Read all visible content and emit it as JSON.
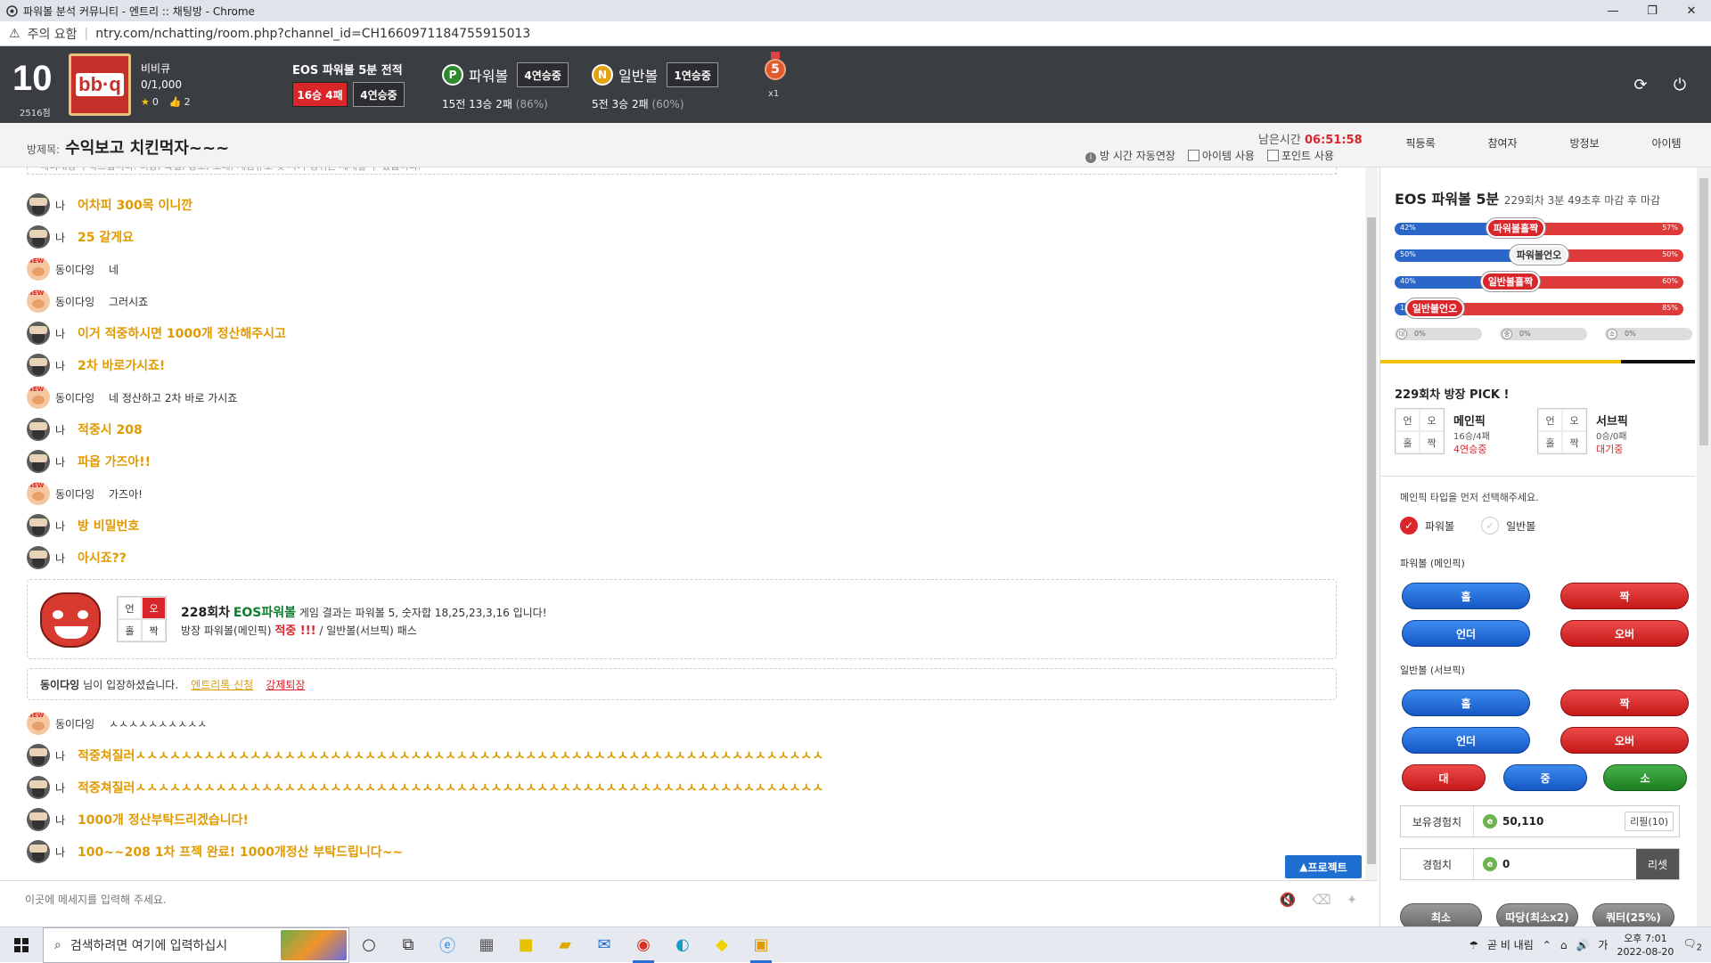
{
  "browser": {
    "title": "파워볼 분석 커뮤니티 - 엔트리 :: 채팅방 - Chrome",
    "warning": "주의 요함",
    "url": "ntry.com/nchatting/room.php?channel_id=CH1660971184755915013"
  },
  "user": {
    "level": "10",
    "points": "2516점",
    "logo_text": "bb·q",
    "name": "비비큐",
    "count": "0/1,000",
    "stars": "0",
    "likes": "2"
  },
  "record": {
    "title": "EOS 파워볼 5분 전적",
    "record_badge": "16승 4패",
    "streak_badge": "4연승중",
    "powerball": {
      "icon": "P",
      "label": "파워볼",
      "streak": "4연승중",
      "summary": "15전 13승 2패",
      "pct": "(86%)"
    },
    "normal": {
      "icon": "N",
      "label": "일반볼",
      "streak": "1연승중",
      "summary": "5전 3승 2패",
      "pct": "(60%)"
    },
    "medal_num": "5",
    "medal_mult": "x1"
  },
  "room": {
    "label": "방제목:",
    "title": "수익보고 치킨먹자~~~",
    "remain_label": "남은시간",
    "remain_time": "06:51:58",
    "opt_auto": "방 시간 자동연장",
    "opt_item": "아이템 사용",
    "opt_point": "포인트 사용",
    "tabs": [
      "픽등록",
      "참여자",
      "방정보",
      "아이템"
    ]
  },
  "chat": {
    "top_cut": "매너채팅 부탁드립니다. 비방, 욕설, 광고, 도배, 게임유도 및 사기 행위는 제재될 수 있습니다.",
    "messages": [
      {
        "who": "나",
        "text": "어차피 300목 이니깐",
        "me": true
      },
      {
        "who": "나",
        "text": "25 갈게요",
        "me": true
      },
      {
        "who": "동이다잉",
        "text": "네",
        "me": false
      },
      {
        "who": "동이다잉",
        "text": "그러시죠",
        "me": false
      },
      {
        "who": "나",
        "text": "이거 적중하시면 1000개 정산해주시고",
        "me": true
      },
      {
        "who": "나",
        "text": "2차 바로가시죠!",
        "me": true
      },
      {
        "who": "동이다잉",
        "text": "네 정산하고 2차 바로 가시죠",
        "me": false
      },
      {
        "who": "나",
        "text": "적중시 208",
        "me": true
      },
      {
        "who": "나",
        "text": "파옵 가즈아!!",
        "me": true
      },
      {
        "who": "동이다잉",
        "text": "가즈아!",
        "me": false
      },
      {
        "who": "나",
        "text": "방 비밀번호",
        "me": true
      },
      {
        "who": "나",
        "text": "아시죠??",
        "me": true
      }
    ],
    "result": {
      "grid": [
        "언",
        "오",
        "홀",
        "짝"
      ],
      "round": "228회차",
      "game": "EOS파워볼",
      "line1_rest": "게임 결과는 파워볼 5, 숫자합 18,25,23,3,16 입니다!",
      "line2_pre": "방장 파워볼(메인픽)",
      "line2_hit": "적중 !!!",
      "line2_post": "/ 일반볼(서브픽) 패스"
    },
    "join": {
      "name": "동이다잉",
      "text": "님이 입장하셨습니다.",
      "link1": "엔트리톡 신청",
      "link2": "강제퇴장"
    },
    "messages2": [
      {
        "who": "동이다잉",
        "text": "ㅅㅅㅅㅅㅅㅅㅅㅅㅅㅅ",
        "me": false
      },
      {
        "who": "나",
        "text": "적중쳐질러ㅅㅅㅅㅅㅅㅅㅅㅅㅅㅅㅅㅅㅅㅅㅅㅅㅅㅅㅅㅅㅅㅅㅅㅅㅅㅅㅅㅅㅅㅅㅅㅅㅅㅅㅅㅅㅅㅅㅅㅅㅅㅅㅅㅅㅅㅅㅅㅅㅅㅅㅅㅅㅅㅅㅅㅅㅅㅅㅅㅅ",
        "me": true
      },
      {
        "who": "나",
        "text": "적중쳐질러ㅅㅅㅅㅅㅅㅅㅅㅅㅅㅅㅅㅅㅅㅅㅅㅅㅅㅅㅅㅅㅅㅅㅅㅅㅅㅅㅅㅅㅅㅅㅅㅅㅅㅅㅅㅅㅅㅅㅅㅅㅅㅅㅅㅅㅅㅅㅅㅅㅅㅅㅅㅅㅅㅅㅅㅅㅅㅅㅅㅅ",
        "me": true
      },
      {
        "who": "나",
        "text": "1000개 정산부탁드리겠습니다!",
        "me": true
      },
      {
        "who": "나",
        "text": "100~~208 1차 프젝 완료! 1000개정산 부탁드립니다~~",
        "me": true
      }
    ],
    "protect_btn": "프로젝트",
    "input_placeholder": "이곳에 메세지를 입력해 주세요."
  },
  "panel": {
    "game": "EOS 파워볼 5분",
    "round_info": "229회차 3분 49초후 마감 후 마감",
    "bars": [
      {
        "label": "파워볼홀짝",
        "left": "42%",
        "right": "57%",
        "lv": 0.42,
        "rv": 0.57
      },
      {
        "label": "파워볼언오",
        "left": "50%",
        "right": "50%",
        "lv": 0.5,
        "rv": 0.5
      },
      {
        "label": "일반볼홀짝",
        "left": "40%",
        "right": "60%",
        "lv": 0.4,
        "rv": 0.6
      },
      {
        "label": "일반볼언오",
        "left": "14%",
        "right": "85%",
        "lv": 0.14,
        "rv": 0.85
      }
    ],
    "small": [
      {
        "icon": "대",
        "value": "0%"
      },
      {
        "icon": "중",
        "value": "0%"
      },
      {
        "icon": "소",
        "value": "0%"
      }
    ],
    "pick_title": "229회차 방장 PICK !",
    "main_pick": {
      "grid": [
        "언",
        "오",
        "홀",
        "짝"
      ],
      "title": "메인픽",
      "record": "16승/4패",
      "status": "4연승중"
    },
    "sub_pick": {
      "grid": [
        "언",
        "오",
        "홀",
        "짝"
      ],
      "title": "서브픽",
      "record": "0승/0패",
      "status": "대기중"
    },
    "hint": "메인픽 타입을 먼저 선택해주세요.",
    "radio_power": "파워볼",
    "radio_normal": "일반볼",
    "sect_power": "파워볼 (메인픽)",
    "sect_normal": "일반볼 (서브픽)",
    "btn_odd": "홀",
    "btn_even": "짝",
    "btn_under": "언더",
    "btn_over": "오버",
    "btn_big": "대",
    "btn_mid": "중",
    "btn_small": "소",
    "exp_label": "보유경험치",
    "exp_value": "50,110",
    "exp_action": "리필(10)",
    "cur_label": "경험치",
    "cur_value": "0",
    "reset": "리셋",
    "bottom_btns": [
      "최소",
      "따당(최소x2)",
      "쿼터(25%)"
    ]
  },
  "taskbar": {
    "search": "검색하려면 여기에 입력하십시",
    "weather": "곧 비 내림",
    "time": "오후 7:01",
    "date": "2022-08-20",
    "notif": "2"
  }
}
